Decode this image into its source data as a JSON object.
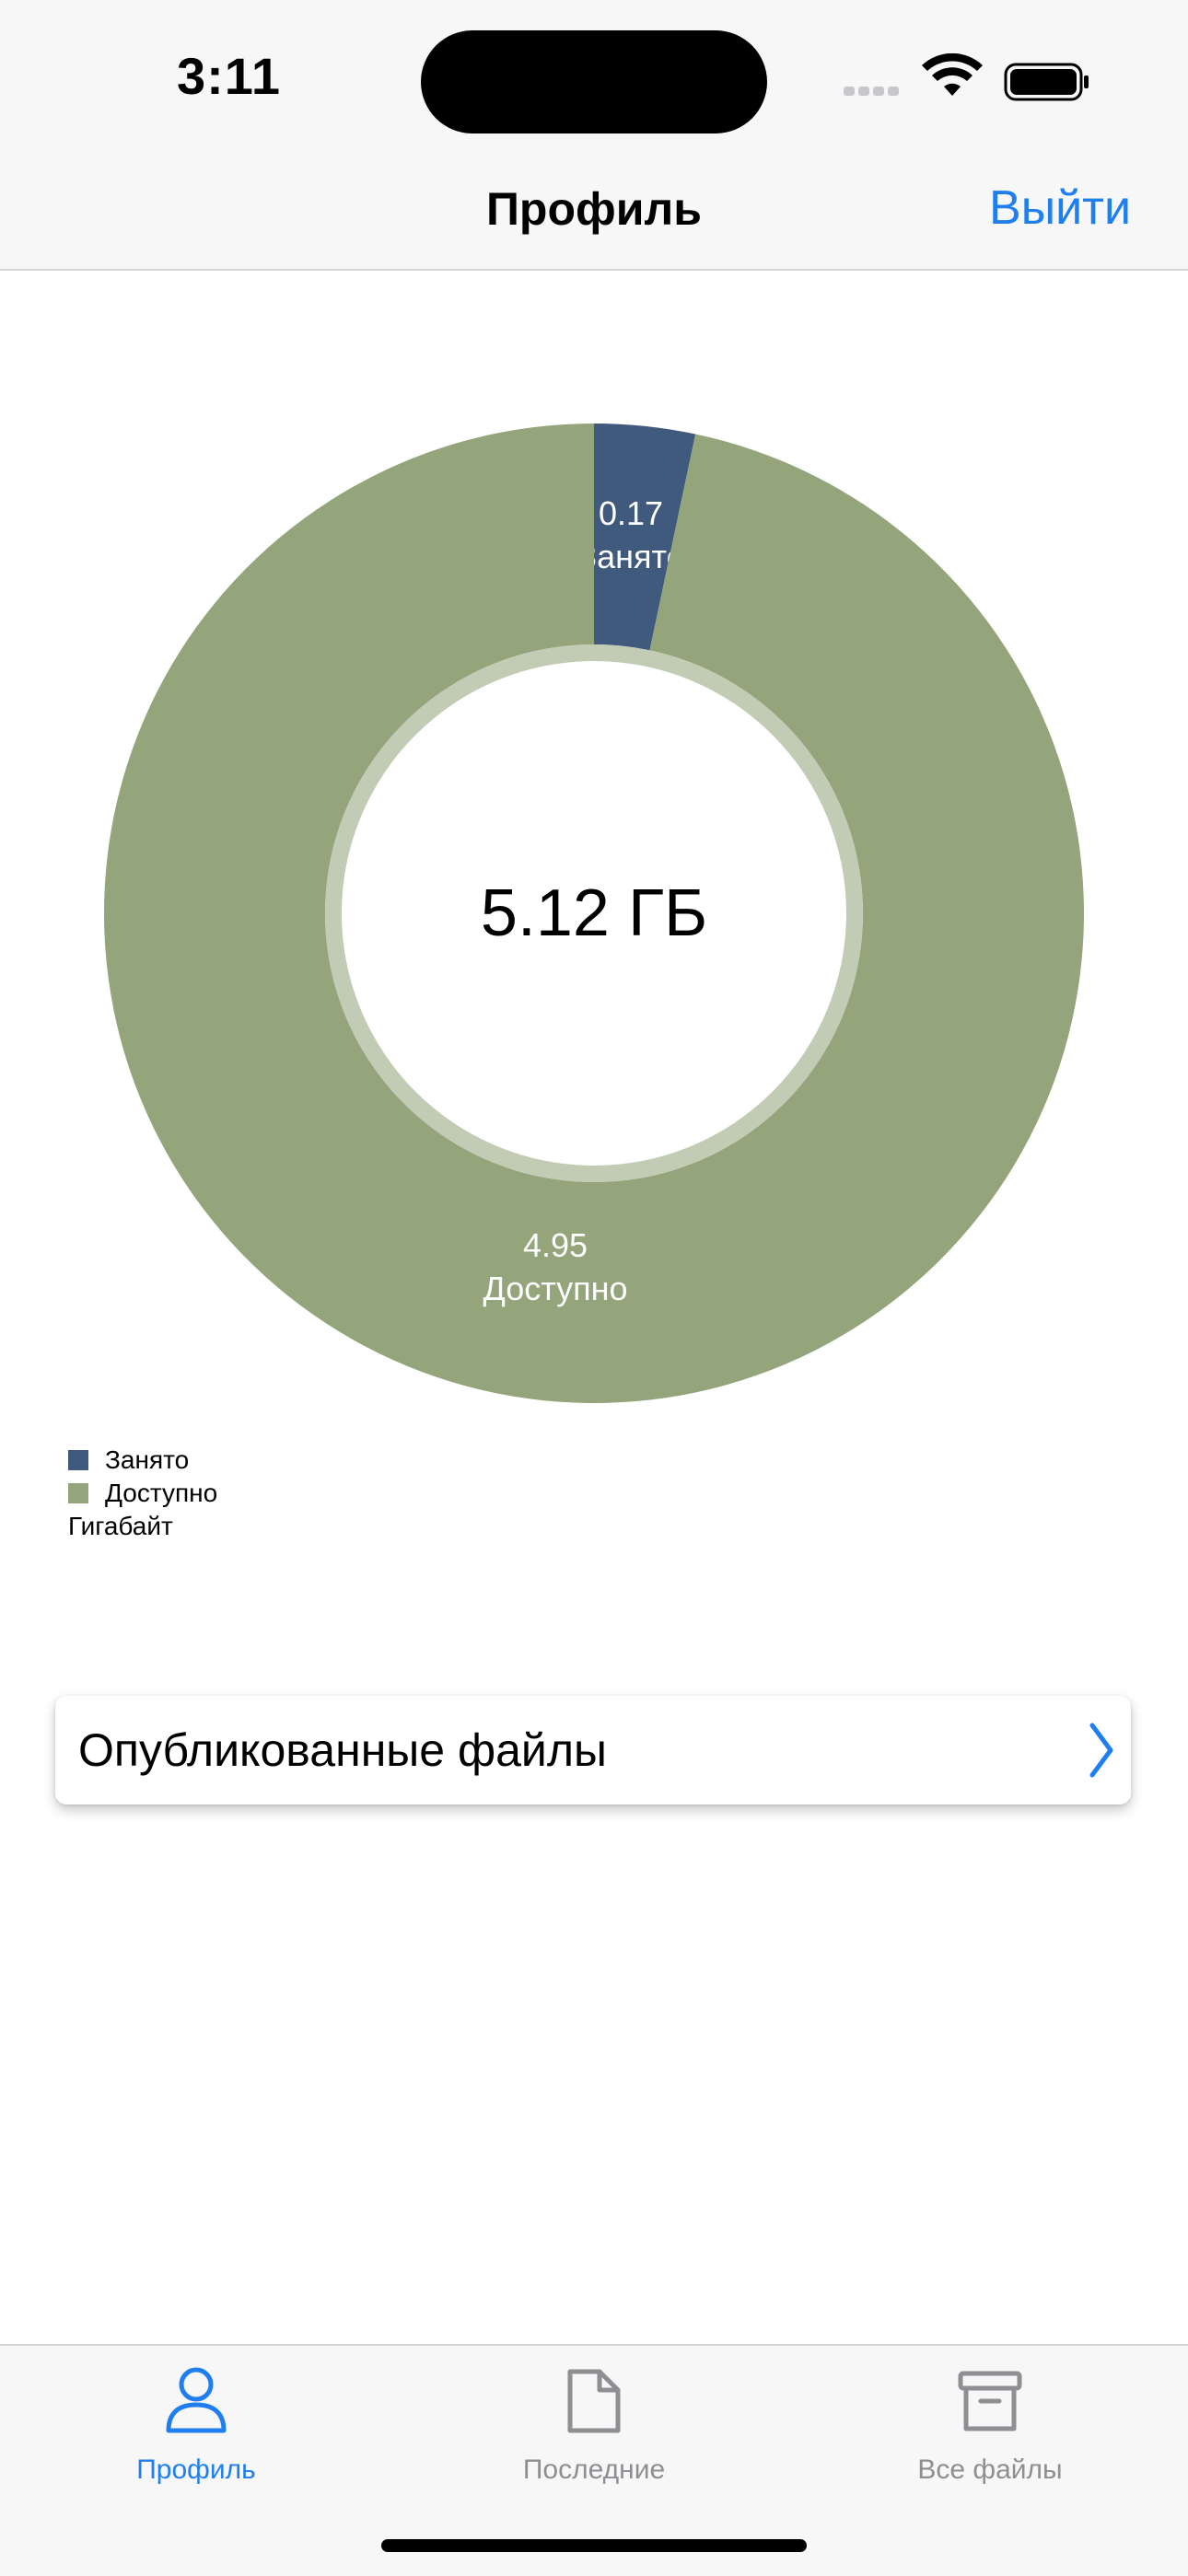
{
  "status_bar": {
    "time": "3:11"
  },
  "nav": {
    "title": "Профиль",
    "logout_label": "Выйти"
  },
  "chart_data": {
    "type": "pie",
    "donut": true,
    "center_label": "5.12 ГБ",
    "categories": [
      "Занято",
      "Доступно"
    ],
    "values": [
      0.17,
      4.95
    ],
    "slice_labels": [
      "0.17",
      "4.95"
    ],
    "colors": [
      "#405a7e",
      "#94a47b"
    ],
    "legend": {
      "items": [
        "Занято",
        "Доступно"
      ],
      "unit": "Гигабайт",
      "placement": "bottom-left"
    }
  },
  "published": {
    "label": "Опубликованные файлы"
  },
  "tabs": [
    {
      "label": "Профиль",
      "icon": "person-icon",
      "active": true
    },
    {
      "label": "Последние",
      "icon": "document-icon",
      "active": false
    },
    {
      "label": "Все файлы",
      "icon": "archive-box-icon",
      "active": false
    }
  ],
  "colors": {
    "accent": "#1f7ef0",
    "inactive": "#8e8e93"
  }
}
